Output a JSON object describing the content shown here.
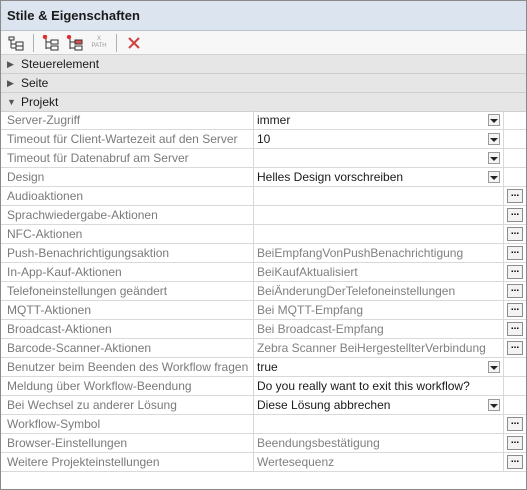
{
  "panel": {
    "title": "Stile & Eigenschaften"
  },
  "toolbar": {
    "icons": [
      "tree-view-icon",
      "add-element-icon",
      "add-element-alt-icon",
      "xpath-icon",
      "delete-icon"
    ],
    "xpath_label_top": "X",
    "xpath_label_bottom": "PATH"
  },
  "sections": [
    {
      "label": "Steuerelement",
      "expanded": false
    },
    {
      "label": "Seite",
      "expanded": false
    },
    {
      "label": "Projekt",
      "expanded": true
    }
  ],
  "properties": [
    {
      "name": "Server-Zugriff",
      "value": "immer",
      "control": "dropdown",
      "dim": false
    },
    {
      "name": "Timeout für Client-Wartezeit auf den Server",
      "value": "10",
      "control": "dropdown",
      "dim": false
    },
    {
      "name": "Timeout für Datenabruf am Server",
      "value": "",
      "control": "dropdown",
      "dim": false
    },
    {
      "name": "Design",
      "value": "Helles Design vorschreiben",
      "control": "dropdown",
      "dim": false
    },
    {
      "name": "Audioaktionen",
      "value": "",
      "control": "ellipsis",
      "dim": false
    },
    {
      "name": "Sprachwiedergabe-Aktionen",
      "value": "",
      "control": "ellipsis",
      "dim": false
    },
    {
      "name": "NFC-Aktionen",
      "value": "",
      "control": "ellipsis",
      "dim": false
    },
    {
      "name": "Push-Benachrichtigungsaktion",
      "value": "BeiEmpfangVonPushBenachrichtigung",
      "control": "ellipsis",
      "dim": true
    },
    {
      "name": "In-App-Kauf-Aktionen",
      "value": "BeiKaufAktualisiert",
      "control": "ellipsis",
      "dim": true
    },
    {
      "name": "Telefoneinstellungen geändert",
      "value": "BeiÄnderungDerTelefoneinstellungen",
      "control": "ellipsis",
      "dim": true
    },
    {
      "name": "MQTT-Aktionen",
      "value": "Bei MQTT-Empfang",
      "control": "ellipsis",
      "dim": true
    },
    {
      "name": "Broadcast-Aktionen",
      "value": "Bei Broadcast-Empfang",
      "control": "ellipsis",
      "dim": true
    },
    {
      "name": "Barcode-Scanner-Aktionen",
      "value": "Zebra Scanner BeiHergestellterVerbindung",
      "control": "ellipsis",
      "dim": true
    },
    {
      "name": "Benutzer beim Beenden des Workflow fragen",
      "value": "true",
      "control": "dropdown",
      "dim": false
    },
    {
      "name": "Meldung über Workflow-Beendung",
      "value": "Do you really want to exit this workflow?",
      "control": "none",
      "dim": false
    },
    {
      "name": "Bei Wechsel zu anderer Lösung",
      "value": "Diese Lösung abbrechen",
      "control": "dropdown",
      "dim": false
    },
    {
      "name": "Workflow-Symbol",
      "value": "",
      "control": "ellipsis",
      "dim": false
    },
    {
      "name": "Browser-Einstellungen",
      "value": "Beendungsbestätigung",
      "control": "ellipsis",
      "dim": true
    },
    {
      "name": "Weitere Projekteinstellungen",
      "value": "Wertesequenz",
      "control": "ellipsis",
      "dim": true
    }
  ],
  "ellipsis_label": "...",
  "colors": {
    "titlebar_bg": "#dce4ef",
    "section_bg": "#e6e6e6",
    "delete_red": "#d04040"
  }
}
